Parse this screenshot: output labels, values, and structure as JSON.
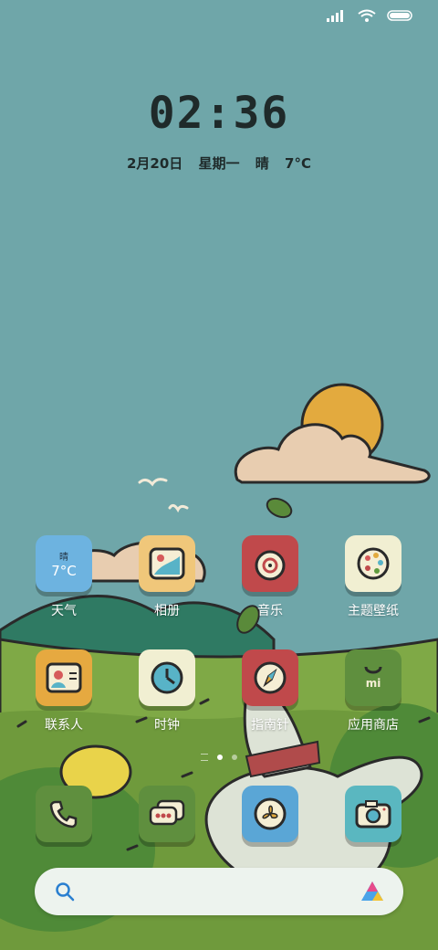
{
  "lockscreen": {
    "time": "02:36",
    "date": "2月20日",
    "weekday": "星期一",
    "weather": "晴",
    "temp": "7°C"
  },
  "weather_widget": {
    "condition": "晴",
    "temp": "7°C"
  },
  "apps_row1": [
    {
      "label": "天气"
    },
    {
      "label": "相册"
    },
    {
      "label": "音乐"
    },
    {
      "label": "主题壁纸"
    }
  ],
  "apps_row2": [
    {
      "label": "联系人"
    },
    {
      "label": "时钟"
    },
    {
      "label": "指南针"
    },
    {
      "label": "应用商店"
    }
  ],
  "dock": [
    {
      "icon": "phone-icon"
    },
    {
      "icon": "messages-icon"
    },
    {
      "icon": "fan-icon"
    },
    {
      "icon": "camera-icon"
    }
  ],
  "status_bar": {
    "icons": [
      "signal-icon",
      "wifi-icon",
      "battery-icon"
    ]
  },
  "page_indicator": {
    "pages": 2,
    "current": 1
  },
  "colors": {
    "sky": "#6fa6a9",
    "hill": "#5f9a3d",
    "sun": "#e0a63a"
  }
}
